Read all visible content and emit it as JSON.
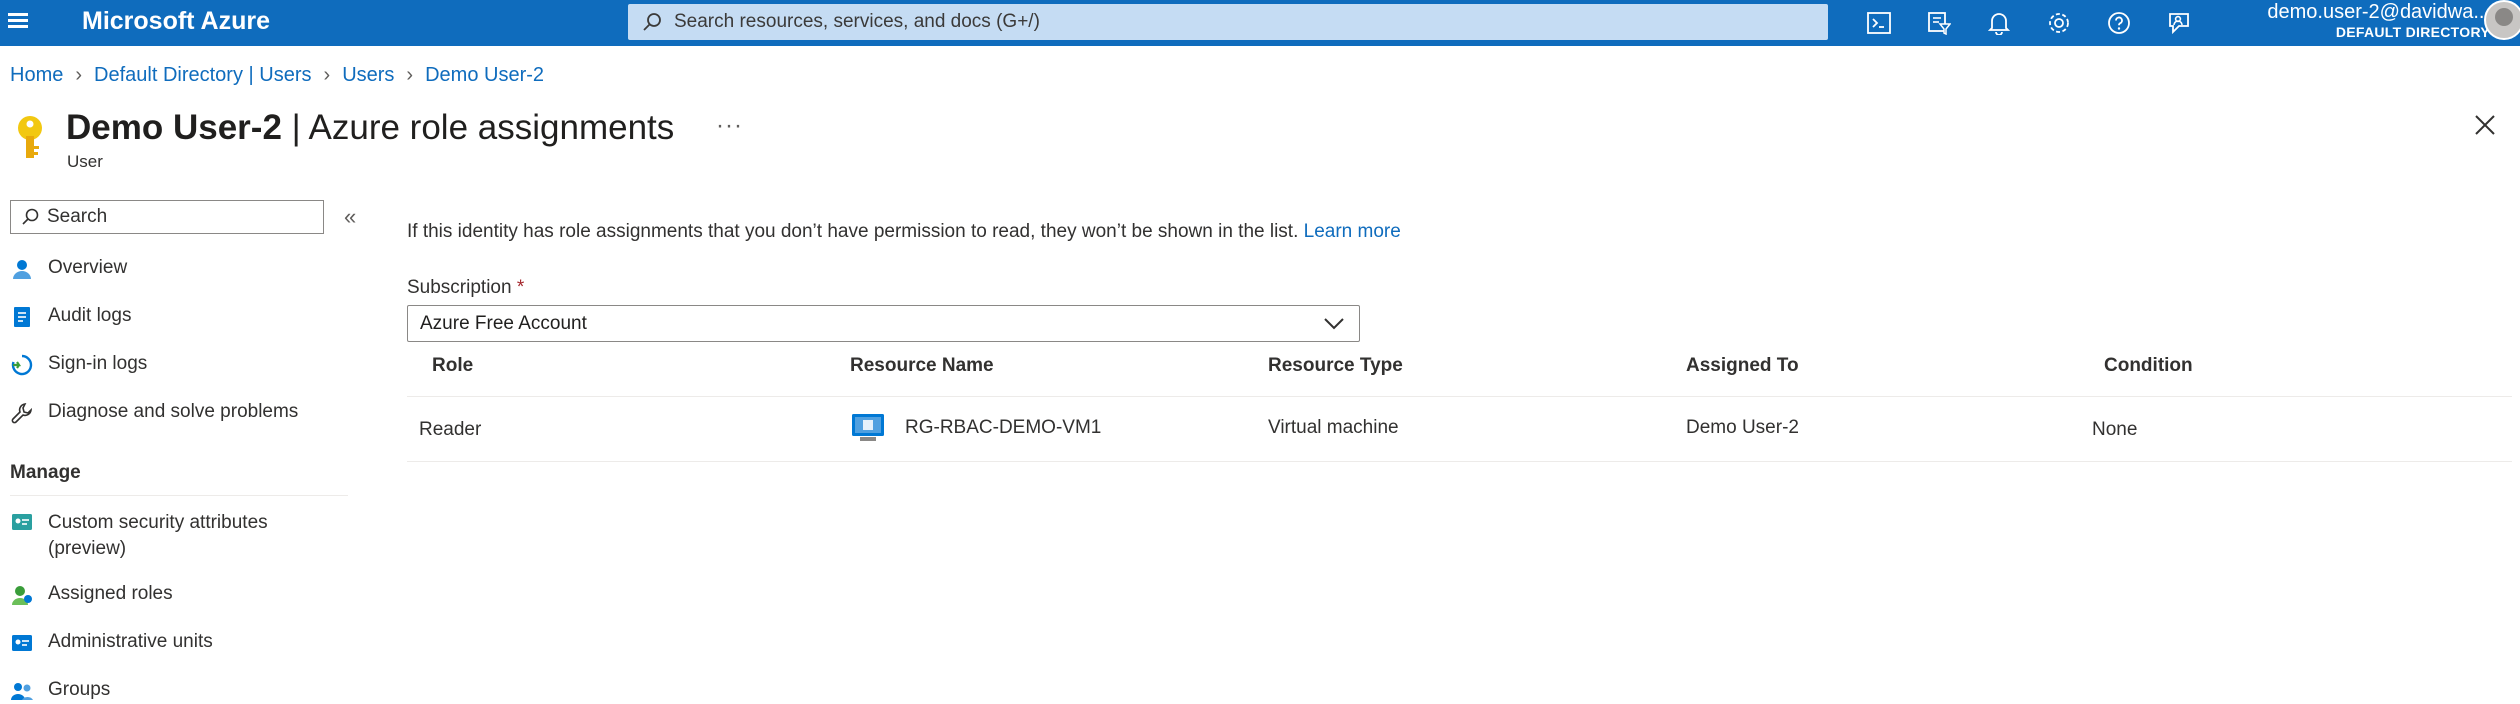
{
  "topbar": {
    "brand": "Microsoft Azure",
    "search_placeholder": "Search resources, services, and docs (G+/)",
    "user_name": "demo.user-2@davidwa...",
    "user_directory": "DEFAULT DIRECTORY",
    "icons": [
      "cloud-shell-icon",
      "directory-filter-icon",
      "notifications-icon",
      "settings-icon",
      "help-icon",
      "feedback-icon"
    ],
    "accent_color": "#0f6cbd"
  },
  "breadcrumb": [
    "Home",
    "Default Directory | Users",
    "Users",
    "Demo User-2"
  ],
  "page": {
    "title_entity": "Demo User-2",
    "title_rest": " | Azure role assignments",
    "more": "···",
    "subtitle": "User"
  },
  "sidebar": {
    "search_placeholder": "Search",
    "collapse": "«",
    "items": [
      {
        "label": "Overview"
      },
      {
        "label": "Audit logs"
      },
      {
        "label": "Sign-in logs"
      },
      {
        "label": "Diagnose and solve problems"
      }
    ],
    "manage_heading": "Manage",
    "manage_items": [
      {
        "label": "Custom security attributes",
        "label2": "(preview)"
      },
      {
        "label": "Assigned roles"
      },
      {
        "label": "Administrative units"
      },
      {
        "label": "Groups"
      }
    ]
  },
  "main": {
    "info": "If this identity has role assignments that you don’t have permission to read, they won’t be shown in the list.",
    "learn_more": "Learn more",
    "subscription_label": "Subscription",
    "required_mark": "*",
    "subscription_value": "Azure Free Account",
    "columns": [
      "Role",
      "Resource Name",
      "Resource Type",
      "Assigned To",
      "Condition"
    ],
    "rows": [
      {
        "role": "Reader",
        "resource_name": "RG-RBAC-DEMO-VM1",
        "resource_type": "Virtual machine",
        "assigned_to": "Demo User-2",
        "condition": "None"
      }
    ]
  }
}
